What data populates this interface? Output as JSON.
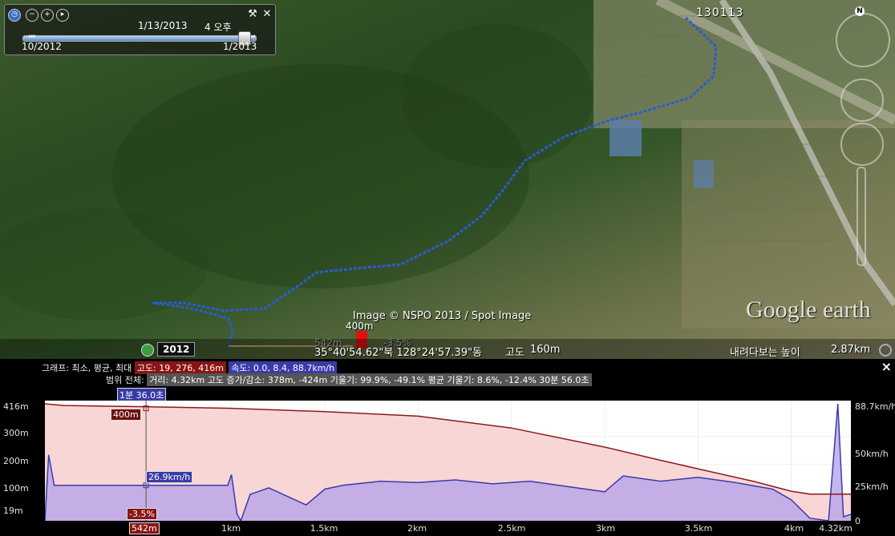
{
  "time_slider": {
    "current_date": "1/13/2013",
    "current_time": "4 오후",
    "range_start": "10/2012",
    "range_end": "1/2013",
    "position": 0.95
  },
  "map": {
    "track_label": "130113",
    "attribution": "Image © NSPO 2013 / Spot Image",
    "marker_altitude": "400m",
    "marker_distance": "542m",
    "marker_slope": "-3.5%",
    "coordinates": "35°40'54.62\"북 128°24'57.39\"동",
    "elevation_label": "고도",
    "elevation_value": "160m",
    "eye_alt_label": "내려다보는 높이",
    "eye_alt_value": "2.87km",
    "year_badge": "2012",
    "google_logo": "Google earth",
    "north_label": "N"
  },
  "profile": {
    "graph_label": "그래프: 최소, 평균, 최대",
    "altitude_stats": "고도: 19, 276, 416m",
    "speed_stats": "속도: 0.0, 8.4, 88.7km/h",
    "range_label": "범위 전체:",
    "range_stats": "거리: 4.32km 고도 증가/감소: 378m, -424m 기울기: 99.9%, -49.1% 평균 기울기: 8.6%, -12.4% 30분 56.0초",
    "time_callout": "1분 36.0초",
    "alt_callout": "400m",
    "speed_callout": "26.9km/h",
    "slope_callout": "-3.5%",
    "dist_callout": "542m",
    "close_label": "×",
    "y_left": [
      "416m",
      "300m",
      "200m",
      "100m",
      "19m"
    ],
    "y_right": [
      "88.7km/h",
      "50km/h",
      "25km/h",
      "0"
    ],
    "x_ticks": [
      "1km",
      "1.5km",
      "2km",
      "2.5km",
      "3km",
      "3.5km",
      "4km",
      "4.32km"
    ]
  },
  "chart_data": {
    "type": "area",
    "x_unit": "km",
    "xlim": [
      0,
      4.32
    ],
    "series": [
      {
        "name": "고도",
        "unit": "m",
        "color": "#8b1a1a",
        "x": [
          0,
          0.1,
          0.5,
          1.0,
          1.5,
          2.0,
          2.5,
          3.0,
          3.3,
          3.5,
          3.8,
          4.0,
          4.1,
          4.32
        ],
        "values": [
          416,
          410,
          406,
          400,
          388,
          372,
          330,
          262,
          215,
          185,
          140,
          105,
          95,
          95
        ]
      },
      {
        "name": "속도",
        "unit": "km/h",
        "color": "#3b3ba8",
        "x": [
          0,
          0.02,
          0.05,
          0.1,
          0.5,
          0.98,
          1.0,
          1.03,
          1.05,
          1.1,
          1.2,
          1.4,
          1.5,
          1.6,
          1.8,
          2.0,
          2.2,
          2.4,
          2.6,
          2.8,
          3.0,
          3.1,
          3.3,
          3.5,
          3.7,
          3.9,
          4.0,
          4.1,
          4.2,
          4.25,
          4.28,
          4.32
        ],
        "values": [
          0,
          50,
          26.9,
          26.9,
          26.9,
          26.9,
          35,
          5,
          0,
          20,
          25,
          12,
          24,
          27,
          30,
          29,
          31,
          28,
          30,
          26,
          22,
          34,
          30,
          33,
          29,
          24,
          16,
          2,
          0,
          88.7,
          3,
          5
        ]
      }
    ],
    "y_left": {
      "label": "고도",
      "unit": "m",
      "range": [
        19,
        416
      ]
    },
    "y_right": {
      "label": "속도",
      "unit": "km/h",
      "range": [
        0,
        88.7
      ]
    },
    "cursor": {
      "x": 0.542,
      "altitude": 400,
      "speed": 26.9,
      "slope": -3.5
    }
  }
}
